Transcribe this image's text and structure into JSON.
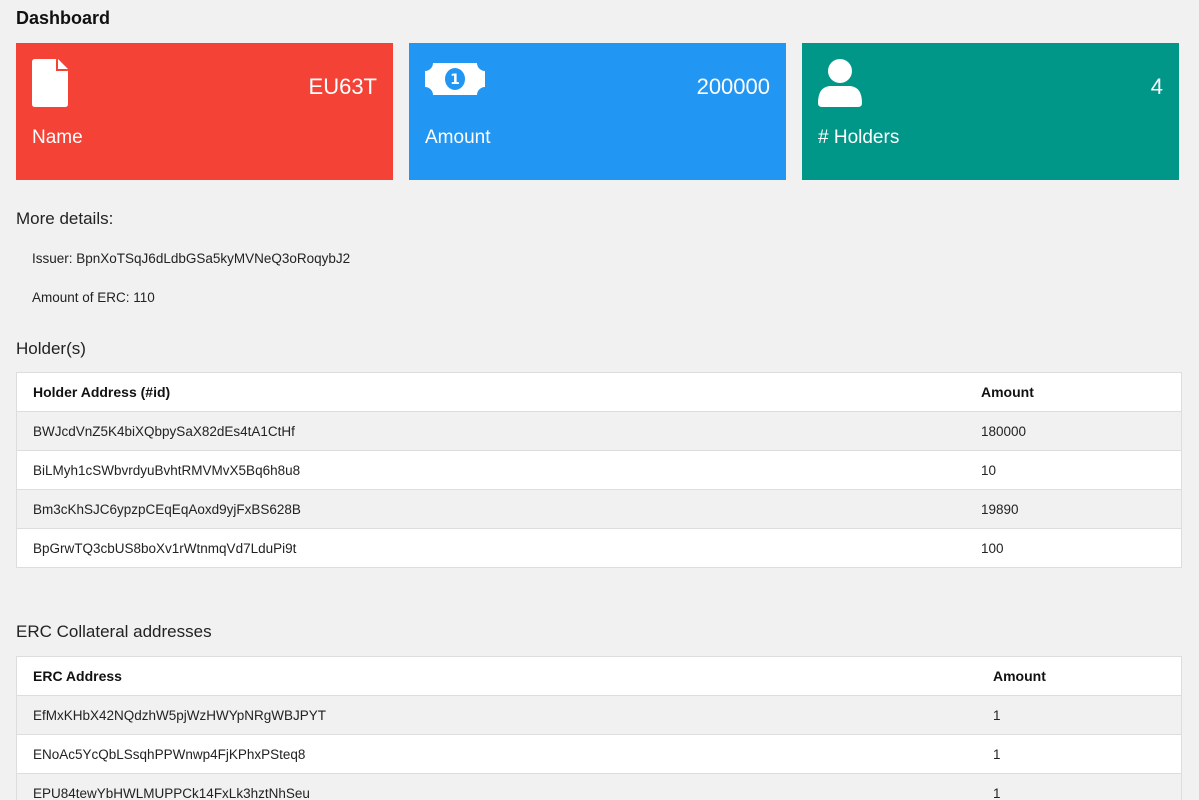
{
  "page_title": "Dashboard",
  "cards": [
    {
      "value": "EU63T",
      "label": "Name",
      "icon": "file-icon",
      "color": "#f44336"
    },
    {
      "value": "200000",
      "label": "Amount",
      "icon": "banknote-icon",
      "color": "#2196f3"
    },
    {
      "value": "4",
      "label": "# Holders",
      "icon": "user-icon",
      "color": "#009688"
    }
  ],
  "details": {
    "title": "More details:",
    "issuer": "Issuer: BpnXoTSqJ6dLdbGSa5kyMVNeQ3oRoqybJ2",
    "amount_erc": "Amount of ERC: 110"
  },
  "holders": {
    "title": "Holder(s)",
    "columns": [
      "Holder Address (#id)",
      "Amount"
    ],
    "rows": [
      {
        "address": "BWJcdVnZ5K4biXQbpySaX82dEs4tA1CtHf",
        "amount": "180000"
      },
      {
        "address": "BiLMyh1cSWbvrdyuBvhtRMVMvX5Bq6h8u8",
        "amount": "10"
      },
      {
        "address": "Bm3cKhSJC6ypzpCEqEqAoxd9yjFxBS628B",
        "amount": "19890"
      },
      {
        "address": "BpGrwTQ3cbUS8boXv1rWtnmqVd7LduPi9t",
        "amount": "100"
      }
    ]
  },
  "erc": {
    "title": "ERC Collateral addresses",
    "columns": [
      "ERC Address",
      "Amount"
    ],
    "rows": [
      {
        "address": "EfMxKHbX42NQdzhW5pjWzHWYpNRgWBJPYT",
        "amount": "1"
      },
      {
        "address": "ENoAc5YcQbLSsqhPPWnwp4FjKPhxPSteq8",
        "amount": "1"
      },
      {
        "address": "EPU84tewYbHWLMUPPCk14FxLk3hztNhSeu",
        "amount": "1"
      }
    ]
  }
}
